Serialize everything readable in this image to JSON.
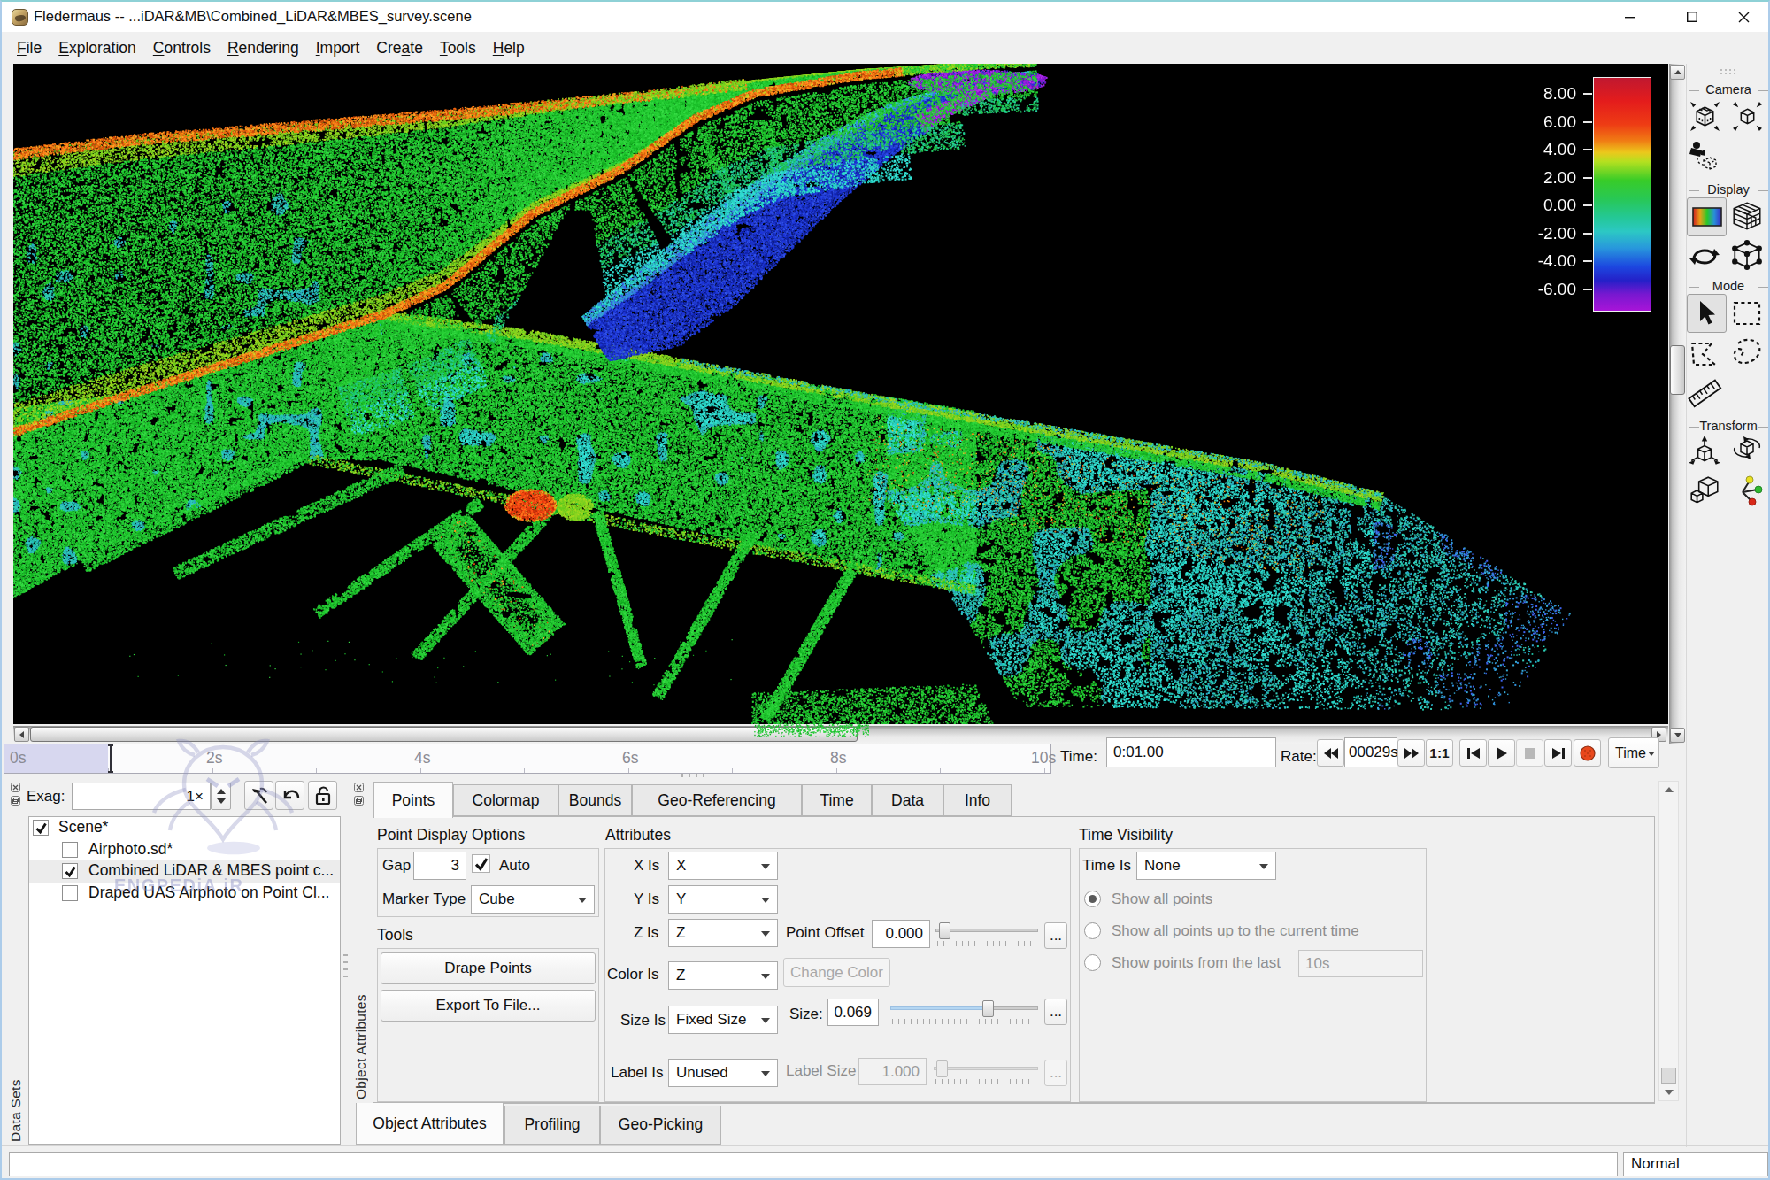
{
  "window": {
    "title": "Fledermaus -- ...iDAR&MB\\Combined_LiDAR&MBES_survey.scene",
    "controls": {
      "minimize": "minimize",
      "maximize": "maximize",
      "close": "close"
    }
  },
  "menu": {
    "items": [
      {
        "pre": "",
        "u": "F",
        "post": "ile"
      },
      {
        "pre": "",
        "u": "E",
        "post": "xploration"
      },
      {
        "pre": "",
        "u": "C",
        "post": "ontrols"
      },
      {
        "pre": "",
        "u": "R",
        "post": "endering"
      },
      {
        "pre": "",
        "u": "I",
        "post": "mport"
      },
      {
        "pre": "Cre",
        "u": "a",
        "post": "te"
      },
      {
        "pre": "",
        "u": "T",
        "post": "ools"
      },
      {
        "pre": "",
        "u": "H",
        "post": "elp"
      }
    ]
  },
  "viewport": {
    "colorbar": {
      "labels": [
        "8.00",
        "6.00",
        "4.00",
        "2.00",
        "0.00",
        "-2.00",
        "-4.00",
        "-6.00"
      ],
      "stops": [
        {
          "c": "#c01830",
          "p": 0
        },
        {
          "c": "#e41c1c",
          "p": 10
        },
        {
          "c": "#ee3c14",
          "p": 20
        },
        {
          "c": "#f07c14",
          "p": 27
        },
        {
          "c": "#ecc81c",
          "p": 32
        },
        {
          "c": "#b4e020",
          "p": 36
        },
        {
          "c": "#38cc28",
          "p": 44
        },
        {
          "c": "#28c855",
          "p": 52
        },
        {
          "c": "#24c896",
          "p": 60
        },
        {
          "c": "#2cc8c4",
          "p": 66
        },
        {
          "c": "#2898dc",
          "p": 73
        },
        {
          "c": "#1c48e0",
          "p": 81
        },
        {
          "c": "#2420c8",
          "p": 87
        },
        {
          "c": "#7818d0",
          "p": 93
        },
        {
          "c": "#a814d8",
          "p": 100
        }
      ]
    },
    "point_cloud": {
      "seed": 20240813,
      "palettes": {
        "green": [
          "#1ec62e",
          "#2bd23a",
          "#19bc26",
          "#35dc44",
          "#24cc33",
          "#12aa20",
          "#2ad038"
        ],
        "lime": [
          "#66cc1c",
          "#8cd41f",
          "#a6d81f",
          "#7ad020"
        ],
        "orange": [
          "#ff8c14",
          "#f07010",
          "#d85408",
          "#ffa428",
          "#c84408",
          "#ff7e1e"
        ],
        "slope": [
          "#1cc244",
          "#22cc66",
          "#1fc688",
          "#26d0a0",
          "#20ba52"
        ],
        "cyan": [
          "#28d4c4",
          "#30dcd0",
          "#1fc0b4",
          "#3ae4d8"
        ],
        "blue": [
          "#1c34d8",
          "#2644e4",
          "#1226b0",
          "#3152ea",
          "#0f1e9c",
          "#2038cc"
        ],
        "lightblue": [
          "#3e63ee",
          "#2f8fd8",
          "#35a8d4"
        ],
        "purple": [
          "#8c1cd8",
          "#a428e4",
          "#7a10c4",
          "#b830ea"
        ],
        "teal": [
          "#22c4a8",
          "#2ab8c4",
          "#35ccb8",
          "#28a8c8",
          "#2fd0b8"
        ],
        "yellow": [
          "#c8cc20",
          "#e0b81c",
          "#d8cc28"
        ],
        "red": [
          "#e83c10",
          "#ff5014",
          "#c42c08",
          "#ff7a1e"
        ]
      },
      "top_crest": [
        [
          -15,
          100
        ],
        [
          137,
          82
        ],
        [
          287,
          70
        ],
        [
          437,
          58
        ],
        [
          587,
          45
        ],
        [
          737,
          30
        ],
        [
          837,
          18
        ],
        [
          957,
          6
        ],
        [
          1090,
          -2
        ],
        [
          1155,
          -5
        ]
      ],
      "bottom_crest": [
        [
          -15,
          420
        ],
        [
          137,
          370
        ],
        [
          287,
          323
        ],
        [
          417,
          282
        ],
        [
          487,
          250
        ],
        [
          587,
          167
        ],
        [
          687,
          118
        ],
        [
          767,
          62
        ],
        [
          837,
          32
        ],
        [
          957,
          12
        ],
        [
          1090,
          0
        ],
        [
          1155,
          -3
        ]
      ],
      "channel_in": [
        [
          642,
          285
        ],
        [
          707,
          230
        ],
        [
          777,
          175
        ],
        [
          847,
          125
        ],
        [
          917,
          80
        ],
        [
          987,
          45
        ],
        [
          1067,
          22
        ],
        [
          1147,
          8
        ]
      ],
      "channel_out": [
        [
          672,
          335
        ],
        [
          752,
          318
        ],
        [
          817,
          270
        ],
        [
          877,
          210
        ],
        [
          937,
          152
        ],
        [
          997,
          100
        ],
        [
          1057,
          58
        ],
        [
          1112,
          32
        ],
        [
          1167,
          15
        ]
      ],
      "waterfront": [
        [
          412,
          280
        ],
        [
          587,
          304
        ],
        [
          797,
          343
        ],
        [
          1007,
          383
        ],
        [
          1252,
          425
        ],
        [
          1417,
          454
        ],
        [
          1547,
          487
        ]
      ],
      "quay": [
        [
          332,
          445
        ],
        [
          537,
          487
        ],
        [
          737,
          528
        ],
        [
          949,
          568
        ],
        [
          1087,
          593
        ]
      ],
      "left_terrain": [
        [
          -15,
          390
        ],
        [
          137,
          370
        ],
        [
          287,
          323
        ],
        [
          417,
          282
        ],
        [
          417,
          447
        ],
        [
          332,
          445
        ],
        [
          107,
          545
        ],
        [
          -15,
          610
        ]
      ],
      "mid_terrain": [
        [
          417,
          282
        ],
        [
          1087,
          392
        ],
        [
          1087,
          600
        ],
        [
          949,
          568
        ],
        [
          417,
          447
        ]
      ],
      "right_terrain": [
        [
          987,
          378
        ],
        [
          1547,
          487
        ],
        [
          1760,
          620
        ],
        [
          1687,
          730
        ],
        [
          1137,
          725
        ],
        [
          987,
          490
        ]
      ],
      "piers": [
        {
          "s": [
            332,
            442
          ],
          "e": [
            79,
            567
          ],
          "w": 15
        },
        {
          "s": [
            439,
            457
          ],
          "e": [
            182,
            575
          ],
          "w": 15
        },
        {
          "s": [
            527,
            495
          ],
          "e": [
            342,
            620
          ],
          "w": 13
        },
        {
          "s": [
            619,
            490
          ],
          "e": [
            454,
            670
          ],
          "w": 13
        },
        {
          "s": [
            659,
            505
          ],
          "e": [
            709,
            680
          ],
          "w": 12
        },
        {
          "s": [
            834,
            530
          ],
          "e": [
            727,
            715
          ],
          "w": 13
        },
        {
          "s": [
            949,
            567
          ],
          "e": [
            849,
            740
          ],
          "w": 13
        }
      ],
      "boat": {
        "s": [
          492,
          525
        ],
        "e": [
          602,
          650
        ],
        "w": 27
      },
      "red_blob": {
        "c": [
          584,
          498
        ],
        "rx": 29,
        "ry": 18
      },
      "green_knob": {
        "c": [
          634,
          500
        ],
        "rx": 20,
        "ry": 15
      },
      "purple_cap": {
        "c": [
          1088,
          20
        ],
        "rx": 78,
        "ry": 14
      },
      "shore": [
        [
          834,
          710
        ],
        [
          1087,
          700
        ],
        [
          1107,
          746
        ],
        [
          834,
          746
        ]
      ]
    }
  },
  "timeline": {
    "ticks": [
      "0s",
      "2s",
      "4s",
      "6s",
      "8s",
      "10s"
    ],
    "time_label": "Time:",
    "time_value": "0:01.00",
    "rate_label": "Rate:",
    "rate_value": "00029s",
    "ratio_label": "1:1",
    "mode_value": "Time"
  },
  "right_panel": {
    "sections": [
      {
        "title": "Camera"
      },
      {
        "title": "Display"
      },
      {
        "title": "Mode"
      },
      {
        "title": "Transform"
      }
    ]
  },
  "datasets": {
    "dock_title": "Data Sets",
    "exag_label": "Exag:",
    "exag_value": "1×",
    "items": [
      {
        "label": "Scene*",
        "checked": true,
        "selected": false
      },
      {
        "label": "Airphoto.sd*",
        "checked": false,
        "selected": false
      },
      {
        "label": "Combined LiDAR & MBES point c...",
        "checked": true,
        "selected": true
      },
      {
        "label": "Draped UAS Airphoto on Point Cl...",
        "checked": false,
        "selected": false
      }
    ]
  },
  "attributes_dock": {
    "dock_title": "Object Attributes",
    "tabs": [
      "Points",
      "Colormap",
      "Bounds",
      "Geo-Referencing",
      "Time",
      "Data",
      "Info"
    ],
    "active_tab": "Points",
    "points_tab": {
      "display_group_title": "Point Display Options",
      "gap_label": "Gap",
      "gap_value": "3",
      "auto_checked": true,
      "auto_label": "Auto",
      "marker_label": "Marker Type",
      "marker_value": "Cube",
      "tools_title": "Tools",
      "drape_button": "Drape Points",
      "export_button": "Export To File...",
      "attributes_group_title": "Attributes",
      "x_label": "X Is",
      "x_value": "X",
      "y_label": "Y Is",
      "y_value": "Y",
      "z_label": "Z Is",
      "z_value": "Z",
      "color_label": "Color Is",
      "color_value": "Z",
      "size_is_label": "Size Is",
      "size_is_value": "Fixed Size",
      "label_is_label": "Label Is",
      "label_is_value": "Unused",
      "point_offset_label": "Point Offset",
      "point_offset_value": "0.000",
      "point_offset_pct": 9,
      "change_color_button": "Change Color",
      "size_label": "Size:",
      "size_value": "0.069",
      "size_pct": 66,
      "label_size_label": "Label Size",
      "label_size_value": "1.000",
      "label_size_pct": 8,
      "ellipsis": "...",
      "time_visibility": {
        "title": "Time Visibility",
        "time_is_label": "Time Is",
        "time_is_value": "None",
        "radios": [
          {
            "label": "Show all points",
            "selected": true
          },
          {
            "label": "Show all points up to the current time",
            "selected": false
          },
          {
            "label": "Show points from the last",
            "selected": false
          }
        ],
        "last_value": "10s"
      }
    },
    "bottom_tabs": [
      "Object Attributes",
      "Profiling",
      "Geo-Picking"
    ],
    "active_bottom_tab": "Object Attributes"
  },
  "status_bar": {
    "input_value": "",
    "mode_value": "Normal"
  },
  "watermark": {
    "text": "ENGPEDiA.iR"
  }
}
